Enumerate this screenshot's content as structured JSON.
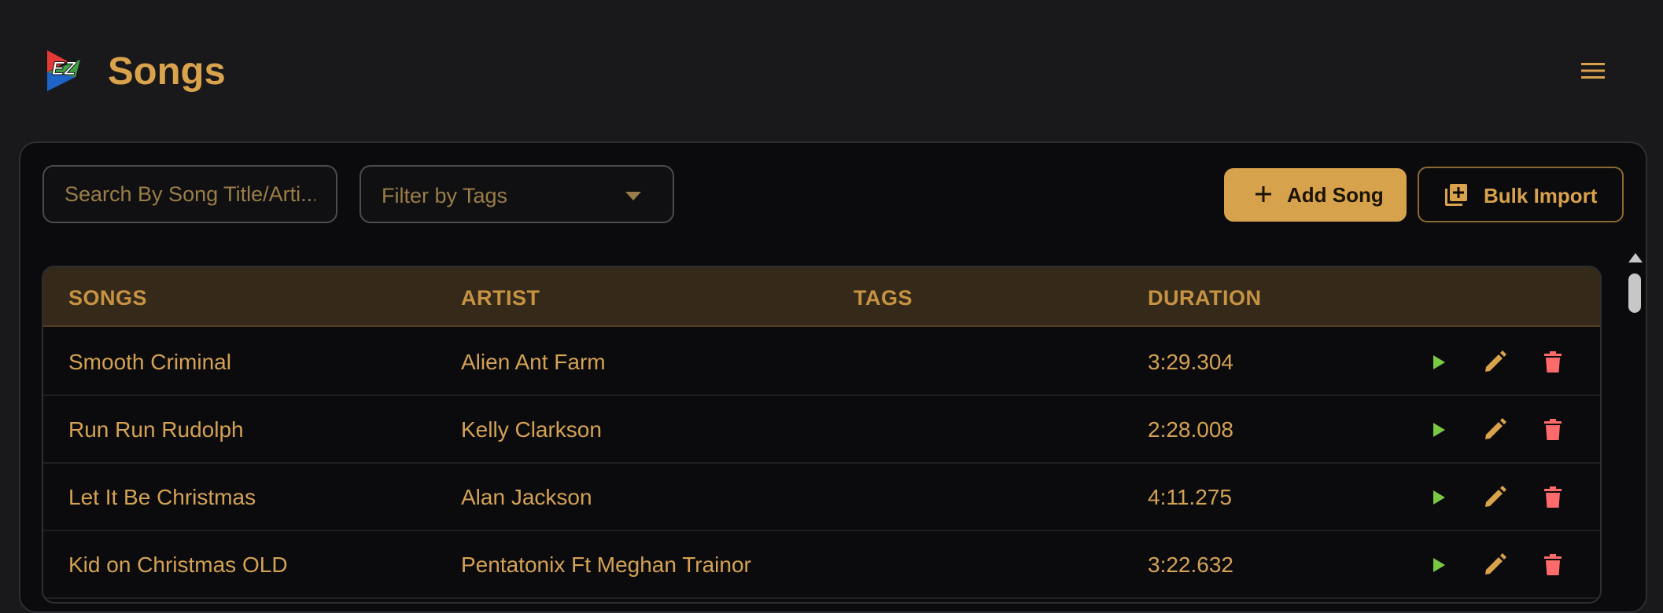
{
  "header": {
    "title": "Songs",
    "logo_text": "EZ",
    "menu_icon": "hamburger-menu-icon"
  },
  "toolbar": {
    "search_placeholder": "Search By Song Title/Arti...",
    "tag_filter_placeholder": "Filter by Tags",
    "add_song_label": "Add Song",
    "bulk_import_label": "Bulk Import"
  },
  "table": {
    "columns": [
      "SONGS",
      "ARTIST",
      "TAGS",
      "DURATION"
    ],
    "rows": [
      {
        "song": "Smooth Criminal",
        "artist": "Alien Ant Farm",
        "tags": "",
        "duration": "3:29.304"
      },
      {
        "song": "Run Run Rudolph",
        "artist": "Kelly Clarkson",
        "tags": "",
        "duration": "2:28.008"
      },
      {
        "song": "Let It Be Christmas",
        "artist": "Alan Jackson",
        "tags": "",
        "duration": "4:11.275"
      },
      {
        "song": "Kid on Christmas OLD",
        "artist": "Pentatonix Ft Meghan Trainor",
        "tags": "",
        "duration": "3:22.632"
      }
    ]
  },
  "colors": {
    "accent": "#d9a24c",
    "background": "#19191b",
    "panel": "#0b0b0d",
    "play": "#7ac943",
    "delete": "#ff6b6b"
  }
}
